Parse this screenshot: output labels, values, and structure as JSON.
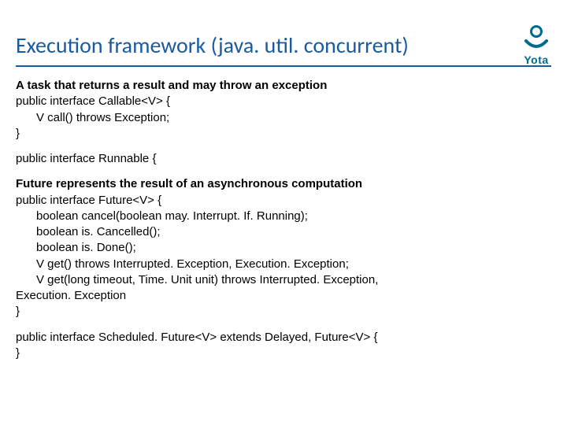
{
  "title": "Execution framework (java. util. concurrent)",
  "logo": {
    "label": "Yota"
  },
  "sections": {
    "callable": {
      "heading": "A task that returns a result and may throw an exception",
      "l1": "public interface Callable<V> {",
      "l2": "V call() throws Exception;",
      "l3": "}"
    },
    "runnable": {
      "l1": "public  interface Runnable {"
    },
    "future": {
      "heading": "Future represents the result of an asynchronous computation",
      "l1": "public interface Future<V> {",
      "l2": "boolean cancel(boolean may. Interrupt. If. Running);",
      "l3": "boolean is. Cancelled();",
      "l4": "boolean is. Done();",
      "l5": "V get() throws Interrupted. Exception, Execution. Exception;",
      "l6": "V get(long timeout, Time. Unit unit)   throws Interrupted. Exception,",
      "l7": "Execution. Exception",
      "l8": "}"
    },
    "scheduled": {
      "l1": "public interface Scheduled. Future<V> extends Delayed, Future<V> {",
      "l2": "}"
    }
  }
}
